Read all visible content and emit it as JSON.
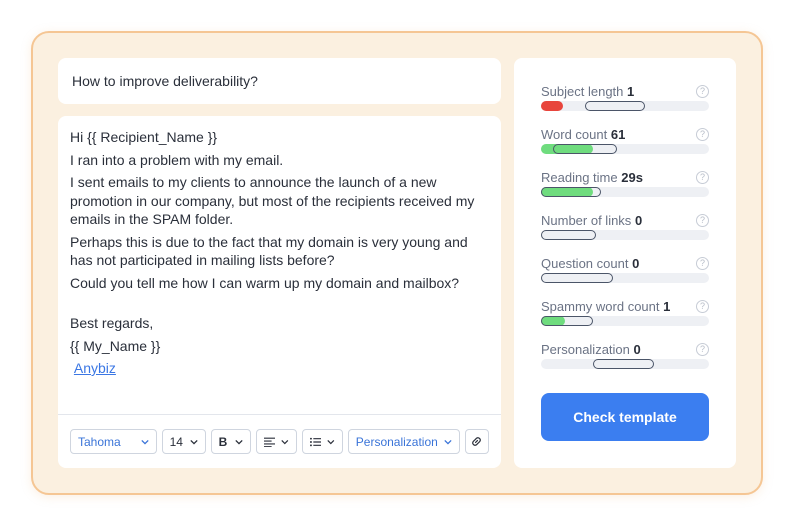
{
  "subject": {
    "value": "How to improve deliverability?"
  },
  "editor": {
    "greeting": "Hi {{ Recipient_Name }}",
    "lines": [
      " I ran into a problem with my email.",
      " I sent emails to my clients to announce the launch of a new promotion in our company, but most of the recipients received my emails in the SPAM folder.",
      " Perhaps this is due to the fact that my domain is very young and has not participated in mailing lists before?",
      "Could you tell me how I can warm up my domain and mailbox?"
    ],
    "signoff": " Best regards,",
    "name_var": "{{ My_Name }}",
    "link_text": "Anybiz"
  },
  "toolbar": {
    "font": "Tahoma",
    "size": "14",
    "bold": "B",
    "personalization": "Personalization"
  },
  "metrics": [
    {
      "label": "Subject length",
      "value": "1",
      "fill": 0.13,
      "fill_color": "#e8453c",
      "range_start": 0.26,
      "range_end": 0.62
    },
    {
      "label": "Word count",
      "value": "61",
      "fill": 0.31,
      "fill_color": "#6fdc7e",
      "range_start": 0.07,
      "range_end": 0.45
    },
    {
      "label": "Reading time",
      "value": "29s",
      "fill": 0.31,
      "fill_color": "#6fdc7e",
      "range_start": 0.0,
      "range_end": 0.36
    },
    {
      "label": "Number of links",
      "value": "0",
      "fill": 0.0,
      "fill_color": "#6fdc7e",
      "range_start": 0.0,
      "range_end": 0.33
    },
    {
      "label": "Question count",
      "value": "0",
      "fill": 0.0,
      "fill_color": "#6fdc7e",
      "range_start": 0.0,
      "range_end": 0.43
    },
    {
      "label": "Spammy word count",
      "value": "1",
      "fill": 0.14,
      "fill_color": "#6fdc7e",
      "range_start": 0.0,
      "range_end": 0.31
    },
    {
      "label": "Personalization",
      "value": "0",
      "fill": 0.0,
      "fill_color": "#6fdc7e",
      "range_start": 0.31,
      "range_end": 0.67
    }
  ],
  "check_button": "Check template",
  "colors": {
    "accent": "#3b7ef0",
    "frame_border": "#f5c694",
    "frame_bg": "#fbf0e0",
    "bad": "#e8453c",
    "good": "#6fdc7e"
  }
}
